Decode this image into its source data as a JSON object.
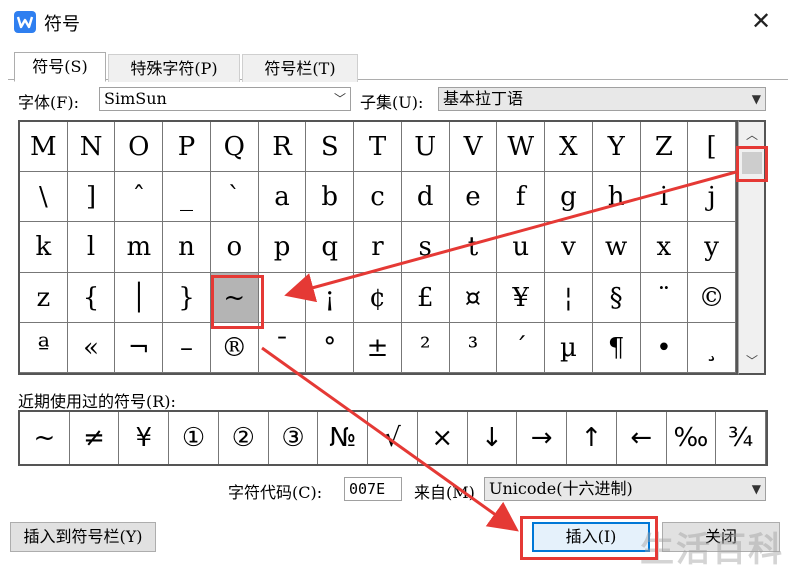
{
  "window": {
    "title": "符号",
    "close_glyph": "✕"
  },
  "tabs": [
    {
      "label": "符号(S)",
      "active": true
    },
    {
      "label": "特殊字符(P)",
      "active": false
    },
    {
      "label": "符号栏(T)",
      "active": false
    }
  ],
  "font": {
    "label": "字体(F):",
    "value": "SimSun"
  },
  "subset": {
    "label": "子集(U):",
    "value": "基本拉丁语"
  },
  "symbol_grid": {
    "rows": [
      [
        "M",
        "N",
        "O",
        "P",
        "Q",
        "R",
        "S",
        "T",
        "U",
        "V",
        "W",
        "X",
        "Y",
        "Z",
        "["
      ],
      [
        "\\",
        "]",
        "ˆ",
        "_",
        "`",
        "a",
        "b",
        "c",
        "d",
        "e",
        "f",
        "g",
        "h",
        "i",
        "j"
      ],
      [
        "k",
        "l",
        "m",
        "n",
        "o",
        "p",
        "q",
        "r",
        "s",
        "t",
        "u",
        "v",
        "w",
        "x",
        "y"
      ],
      [
        "z",
        "{",
        "│",
        "}",
        "~",
        " ",
        "¡",
        "¢",
        "£",
        "¤",
        "¥",
        "¦",
        "§",
        "¨",
        "©"
      ],
      [
        "ª",
        "«",
        "¬",
        "–",
        "®",
        "¯",
        "°",
        "±",
        "²",
        "³",
        "´",
        "µ",
        "¶",
        "•",
        "¸"
      ]
    ],
    "selected": "~"
  },
  "recent": {
    "label": "近期使用过的符号(R):",
    "symbols": [
      "~",
      "≠",
      "¥",
      "①",
      "②",
      "③",
      "№",
      "√",
      "×",
      "↓",
      "→",
      "↑",
      "←",
      "‰",
      "¾"
    ]
  },
  "char_code": {
    "label": "字符代码(C):",
    "value": "007E"
  },
  "from": {
    "label": "来自(M)",
    "value": "Unicode(十六进制)"
  },
  "buttons": {
    "insert_to_bar": "插入到符号栏(Y)",
    "insert": "插入(I)",
    "close": "关闭"
  },
  "watermark": "生活百科",
  "colors": {
    "accent_red": "#e53935",
    "selected_cell": "#b4b4b4",
    "app_icon": "#2f7ff0"
  }
}
